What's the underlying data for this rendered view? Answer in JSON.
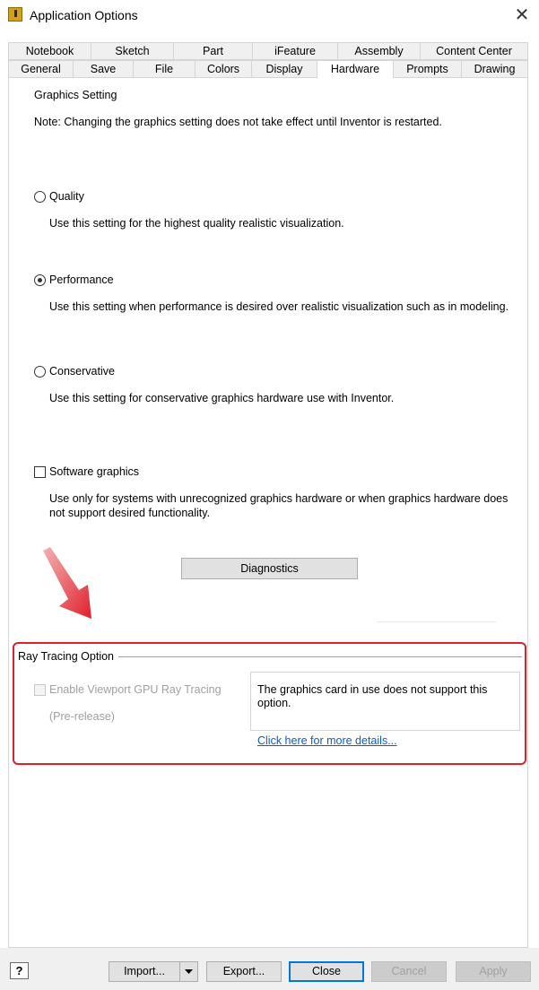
{
  "window": {
    "title": "Application Options",
    "close_glyph": "✕"
  },
  "tabs_row1": [
    "Notebook",
    "Sketch",
    "Part",
    "iFeature",
    "Assembly",
    "Content Center"
  ],
  "tabs_row2": [
    "General",
    "Save",
    "File",
    "Colors",
    "Display",
    "Hardware",
    "Prompts",
    "Drawing"
  ],
  "active_tab": "Hardware",
  "graphics": {
    "heading": "Graphics Setting",
    "note": "Note: Changing the graphics setting does not take effect until Inventor is restarted.",
    "quality_label": "Quality",
    "quality_desc": "Use this setting for the highest quality realistic visualization.",
    "performance_label": "Performance",
    "performance_desc": "Use this setting when performance is desired over realistic visualization such as in modeling.",
    "conservative_label": "Conservative",
    "conservative_desc": "Use this setting for conservative graphics hardware use with Inventor.",
    "software_label": "Software graphics",
    "software_desc_line1": "Use only for systems with unrecognized graphics hardware or when graphics hardware does",
    "software_desc_line2": "not support desired functionality.",
    "selected": "Performance",
    "software_checked": false,
    "diagnostics_label": "Diagnostics"
  },
  "ray_tracing": {
    "heading": "Ray Tracing Option",
    "checkbox_label": "Enable Viewport GPU Ray Tracing",
    "sub_label": "(Pre-release)",
    "info_line1": "The graphics card in use does not support this",
    "info_line2": "option.",
    "details_link": "Click here for more details..."
  },
  "footer": {
    "help_glyph": "?",
    "import_label": "Import...",
    "export_label": "Export...",
    "close_label": "Close",
    "cancel_label": "Cancel",
    "apply_label": "Apply"
  },
  "colors": {
    "highlight_border": "#e0202c",
    "arrow": "#e0202c",
    "link": "#0a5cc5",
    "primary_border": "#0078d7"
  }
}
